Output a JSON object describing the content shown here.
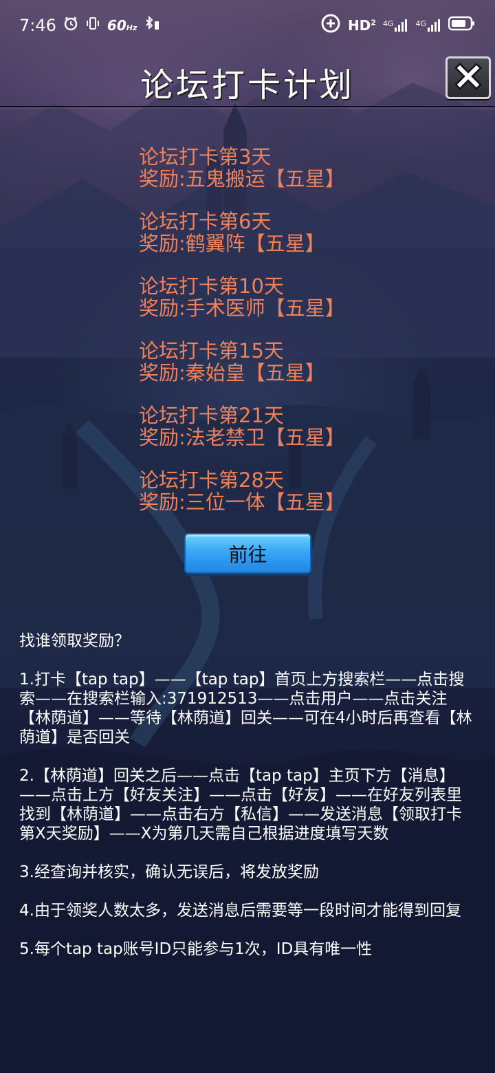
{
  "status_bar": {
    "time": "7:46",
    "refresh": "60",
    "refresh_unit": "Hz",
    "hd": "HD",
    "hd_sub": "2",
    "net1": "4G",
    "net2": "4G"
  },
  "header": {
    "title": "论坛打卡计划"
  },
  "rewards": [
    {
      "day": "论坛打卡第3天",
      "reward": "奖励:五鬼搬运【五星】"
    },
    {
      "day": "论坛打卡第6天",
      "reward": "奖励:鹤翼阵【五星】"
    },
    {
      "day": "论坛打卡第10天",
      "reward": "奖励:手术医师【五星】"
    },
    {
      "day": "论坛打卡第15天",
      "reward": "奖励:秦始皇【五星】"
    },
    {
      "day": "论坛打卡第21天",
      "reward": "奖励:法老禁卫【五星】"
    },
    {
      "day": "论坛打卡第28天",
      "reward": "奖励:三位一体【五星】"
    }
  ],
  "go_button": "前往",
  "instructions": {
    "question": "找谁领取奖励？",
    "items": [
      "1.打卡【tap tap】——【tap tap】首页上方搜索栏——点击搜索——在搜索栏输入:371912513——点击用户——点击关注【林荫道】——等待【林荫道】回关——可在4小时后再查看【林荫道】是否回关",
      "2.【林荫道】回关之后——点击【tap tap】主页下方【消息】——点击上方【好友关注】——点击【好友】——在好友列表里找到【林荫道】——点击右方【私信】——发送消息【领取打卡第X天奖励】——X为第几天需自己根据进度填写天数",
      "3.经查询并核实，确认无误后，将发放奖励",
      "4.由于领奖人数太多，发送消息后需要等一段时间才能得到回复",
      "5.每个tap tap账号ID只能参与1次，ID具有唯一性"
    ]
  },
  "colors": {
    "reward_text": "#f0815a",
    "button_blue": "#3aa6f4"
  }
}
